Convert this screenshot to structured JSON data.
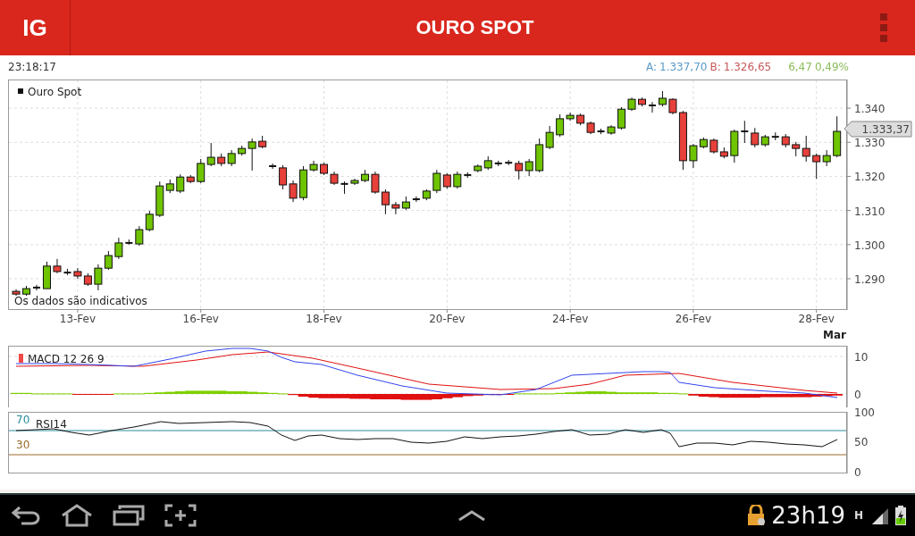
{
  "app_bar": {
    "logo": "IG",
    "title": "OURO SPOT"
  },
  "quote": {
    "time": "23:18:17",
    "ask_label": "A:",
    "ask": "1.337,70",
    "bid_label": "B:",
    "bid": "1.326,65",
    "change": "6,47",
    "change_percent": "0,49%"
  },
  "price_chart": {
    "note": "Os dados são indicativos",
    "next_month": "Mar",
    "last_price": "1.333,37",
    "chart_data": {
      "type": "candlestick",
      "title": "Ouro Spot",
      "categories": [
        null,
        null,
        null,
        null,
        null,
        null,
        "13-Fev",
        null,
        null,
        null,
        null,
        null,
        null,
        null,
        null,
        null,
        null,
        null,
        "16-Fev",
        null,
        null,
        null,
        null,
        null,
        null,
        null,
        null,
        null,
        null,
        null,
        "18-Fev",
        null,
        null,
        null,
        null,
        null,
        null,
        null,
        null,
        null,
        null,
        null,
        "20-Fev",
        null,
        null,
        null,
        null,
        null,
        null,
        null,
        null,
        null,
        null,
        null,
        "24-Fev",
        null,
        null,
        null,
        null,
        null,
        null,
        null,
        null,
        null,
        null,
        null,
        "26-Fev",
        null,
        null,
        null,
        null,
        null,
        null,
        null,
        null,
        null,
        null,
        null,
        "28-Fev",
        null,
        null
      ],
      "ohlc": [
        [
          1286.3,
          1286.9,
          1285.0,
          1285.5
        ],
        [
          1285.5,
          1287.9,
          1285.0,
          1287.1
        ],
        [
          1287.4,
          1288.2,
          1286.6,
          1287.4
        ],
        [
          1287.1,
          1295.0,
          1287.1,
          1293.7
        ],
        [
          1293.7,
          1295.8,
          1291.6,
          1292.1
        ],
        [
          1291.8,
          1292.9,
          1291.1,
          1291.8
        ],
        [
          1292.1,
          1293.1,
          1290.0,
          1290.8
        ],
        [
          1290.8,
          1291.6,
          1287.9,
          1288.4
        ],
        [
          1288.4,
          1294.2,
          1286.6,
          1293.1
        ],
        [
          1293.1,
          1298.1,
          1292.6,
          1296.8
        ],
        [
          1296.5,
          1302.0,
          1295.8,
          1300.5
        ],
        [
          1300.5,
          1301.5,
          1300.0,
          1300.5
        ],
        [
          1300.2,
          1305.4,
          1299.7,
          1304.4
        ],
        [
          1304.4,
          1309.9,
          1303.9,
          1308.9
        ],
        [
          1308.6,
          1318.5,
          1308.1,
          1317.2
        ],
        [
          1315.9,
          1319.1,
          1315.1,
          1317.8
        ],
        [
          1315.7,
          1320.6,
          1315.1,
          1319.8
        ],
        [
          1319.8,
          1320.4,
          1318.0,
          1318.5
        ],
        [
          1318.5,
          1325.1,
          1318.0,
          1323.8
        ],
        [
          1323.5,
          1329.8,
          1323.0,
          1325.6
        ],
        [
          1325.6,
          1326.7,
          1323.0,
          1323.8
        ],
        [
          1323.8,
          1327.7,
          1323.0,
          1326.7
        ],
        [
          1326.7,
          1329.0,
          1326.1,
          1328.2
        ],
        [
          1328.2,
          1331.1,
          1321.7,
          1330.1
        ],
        [
          1330.3,
          1331.9,
          1328.2,
          1328.7
        ],
        [
          1323.0,
          1323.8,
          1322.2,
          1323.0
        ],
        [
          1322.5,
          1323.3,
          1316.2,
          1317.5
        ],
        [
          1317.8,
          1318.8,
          1312.5,
          1313.6
        ],
        [
          1313.8,
          1323.0,
          1313.0,
          1321.9
        ],
        [
          1321.9,
          1324.6,
          1321.4,
          1323.5
        ],
        [
          1323.5,
          1324.0,
          1320.4,
          1320.9
        ],
        [
          1320.6,
          1321.4,
          1317.5,
          1318.0
        ],
        [
          1317.8,
          1318.5,
          1314.9,
          1317.8
        ],
        [
          1318.0,
          1319.3,
          1317.5,
          1318.8
        ],
        [
          1318.8,
          1321.9,
          1318.3,
          1320.6
        ],
        [
          1320.6,
          1321.4,
          1314.9,
          1315.4
        ],
        [
          1315.4,
          1316.2,
          1308.9,
          1311.7
        ],
        [
          1311.7,
          1312.5,
          1308.9,
          1310.7
        ],
        [
          1310.7,
          1314.1,
          1310.2,
          1312.5
        ],
        [
          1313.3,
          1314.1,
          1312.5,
          1313.3
        ],
        [
          1313.6,
          1316.2,
          1313.0,
          1315.7
        ],
        [
          1315.9,
          1321.9,
          1315.1,
          1320.9
        ],
        [
          1320.4,
          1320.9,
          1316.4,
          1317.0
        ],
        [
          1317.0,
          1321.4,
          1316.4,
          1320.6
        ],
        [
          1320.4,
          1321.2,
          1319.6,
          1320.4
        ],
        [
          1321.7,
          1323.5,
          1321.2,
          1323.0
        ],
        [
          1322.5,
          1325.9,
          1321.9,
          1324.6
        ],
        [
          1323.8,
          1324.6,
          1323.0,
          1323.8
        ],
        [
          1324.0,
          1324.8,
          1323.3,
          1324.0
        ],
        [
          1323.8,
          1324.6,
          1319.1,
          1321.7
        ],
        [
          1321.7,
          1325.1,
          1320.1,
          1324.3
        ],
        [
          1321.7,
          1331.1,
          1321.2,
          1329.3
        ],
        [
          1328.5,
          1334.8,
          1328.0,
          1332.9
        ],
        [
          1332.2,
          1338.2,
          1331.6,
          1336.9
        ],
        [
          1336.9,
          1338.7,
          1336.3,
          1337.9
        ],
        [
          1337.9,
          1338.4,
          1335.0,
          1335.6
        ],
        [
          1335.6,
          1336.1,
          1332.4,
          1332.9
        ],
        [
          1333.2,
          1334.0,
          1332.4,
          1333.2
        ],
        [
          1332.7,
          1335.0,
          1332.2,
          1334.5
        ],
        [
          1334.2,
          1340.3,
          1333.7,
          1339.7
        ],
        [
          1339.7,
          1343.1,
          1339.2,
          1342.6
        ],
        [
          1342.6,
          1343.1,
          1340.5,
          1341.1
        ],
        [
          1340.8,
          1341.8,
          1338.7,
          1340.8
        ],
        [
          1341.1,
          1345.0,
          1340.5,
          1342.9
        ],
        [
          1342.6,
          1342.9,
          1338.2,
          1338.7
        ],
        [
          1338.7,
          1339.2,
          1321.9,
          1324.6
        ],
        [
          1324.6,
          1329.5,
          1322.5,
          1329.0
        ],
        [
          1328.7,
          1331.4,
          1328.2,
          1330.8
        ],
        [
          1330.6,
          1331.1,
          1326.7,
          1327.2
        ],
        [
          1327.2,
          1328.5,
          1325.3,
          1325.9
        ],
        [
          1326.1,
          1333.7,
          1324.0,
          1333.2
        ],
        [
          1333.2,
          1336.3,
          1329.8,
          1333.2
        ],
        [
          1332.7,
          1334.2,
          1328.5,
          1329.3
        ],
        [
          1329.3,
          1332.2,
          1328.7,
          1331.6
        ],
        [
          1331.6,
          1332.9,
          1330.6,
          1331.6
        ],
        [
          1331.6,
          1332.4,
          1328.5,
          1329.3
        ],
        [
          1329.3,
          1330.1,
          1325.9,
          1328.2
        ],
        [
          1328.2,
          1331.9,
          1324.3,
          1325.9
        ],
        [
          1326.1,
          1326.7,
          1319.3,
          1324.3
        ],
        [
          1324.3,
          1327.7,
          1323.0,
          1326.1
        ],
        [
          1326.1,
          1337.6,
          1325.6,
          1333.2
        ]
      ],
      "ylim": [
        1281.1,
        1348.4
      ],
      "grid": true,
      "yticks": [
        {
          "value": 1290,
          "label": "1.290"
        },
        {
          "value": 1300,
          "label": "1.300"
        },
        {
          "value": 1310,
          "label": "1.310"
        },
        {
          "value": 1320,
          "label": "1.320"
        },
        {
          "value": 1330,
          "label": "1.330"
        },
        {
          "value": 1340,
          "label": "1.340"
        }
      ]
    }
  },
  "macd": {
    "label": "MACD 12 26 9",
    "y_labels": [
      "10",
      "0"
    ]
  },
  "rsi": {
    "label": "RSI14",
    "upper_level": "70",
    "lower_level": "30",
    "y_labels": [
      "100",
      "50",
      "0"
    ]
  },
  "status_bar": {
    "time": "23h19",
    "network_type": "H"
  }
}
